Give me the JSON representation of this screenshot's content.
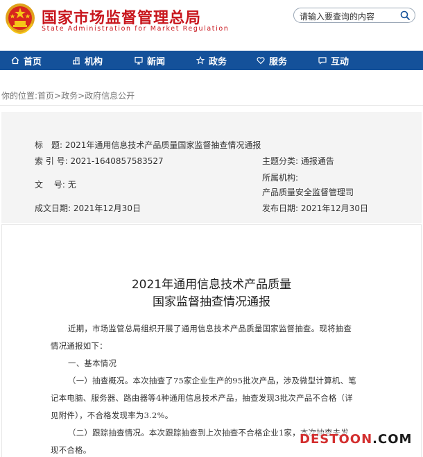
{
  "header": {
    "site_name_cn": "国家市场监督管理总局",
    "site_name_en": "State Administration for Market Regulation",
    "search_placeholder": "请输入要查询的内容"
  },
  "nav": {
    "items": [
      {
        "label": "首页",
        "icon": "home-icon"
      },
      {
        "label": "机构",
        "icon": "building-icon"
      },
      {
        "label": "新闻",
        "icon": "computer-icon"
      },
      {
        "label": "政务",
        "icon": "star-icon"
      },
      {
        "label": "服务",
        "icon": "heart-icon"
      },
      {
        "label": "互动",
        "icon": "chat-icon"
      }
    ]
  },
  "breadcrumb": "你的位置:首页>政务>政府信息公开",
  "info": {
    "title_label": "标　题:",
    "title_value": "2021年通用信息技术产品质量国家监督抽查情况通报",
    "index_label": "索 引 号:",
    "index_value": "2021-1640857583527",
    "category_label": "主题分类:",
    "category_value": "通报通告",
    "doc_label": "文　 号:",
    "doc_value": "无",
    "org_label": "所属机构:",
    "org_value": "产品质量安全监督管理司",
    "created_label": "成文日期:",
    "created_value": "2021年12月30日",
    "published_label": "发布日期:",
    "published_value": "2021年12月30日"
  },
  "article": {
    "title_line1": "2021年通用信息技术产品质量",
    "title_line2": "国家监督抽查情况通报",
    "paragraphs": [
      "近期，市场监管总局组织开展了通用信息技术产品质量国家监督抽查。现将抽查",
      "情况通报如下：",
      "一、基本情况",
      "（一）抽查概况。本次抽查了75家企业生产的95批次产品，涉及微型计算机、笔",
      "记本电脑、服务器、路由器等4种通用信息技术产品，抽查发现3批次产品不合格（详",
      "见附件），不合格发现率为3.2%。",
      "（二）跟踪抽查情况。本次跟踪抽查到上次抽查不合格企业1家，本次抽查未发",
      "现不合格。"
    ]
  },
  "watermark": {
    "part1": "DESTOON",
    "part2": ".COM"
  },
  "colors": {
    "brand_red": "#c8161d",
    "nav_blue": "#14519a",
    "info_bg": "#f4f4f4"
  }
}
